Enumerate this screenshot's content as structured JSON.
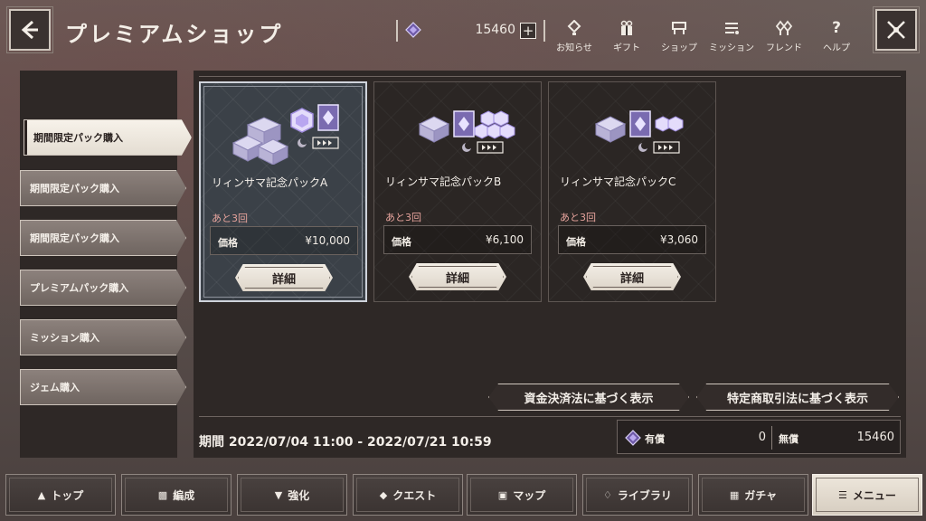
{
  "header": {
    "title": "プレミアムショップ",
    "gem_count": "15460",
    "plus_label": "+",
    "nav": [
      {
        "label": "お知らせ",
        "icon": "notice-icon"
      },
      {
        "label": "ギフト",
        "icon": "gift-icon"
      },
      {
        "label": "ショップ",
        "icon": "shop-icon"
      },
      {
        "label": "ミッション",
        "icon": "mission-icon"
      },
      {
        "label": "フレンド",
        "icon": "friend-icon"
      },
      {
        "label": "ヘルプ",
        "icon": "help-icon"
      }
    ]
  },
  "sidebar": {
    "items": [
      {
        "label": "期間限定パック購入",
        "active": true
      },
      {
        "label": "期間限定パック購入",
        "active": false
      },
      {
        "label": "期間限定パック購入",
        "active": false
      },
      {
        "label": "プレミアムパック購入",
        "active": false
      },
      {
        "label": "ミッション購入",
        "active": false
      },
      {
        "label": "ジェム購入",
        "active": false
      }
    ]
  },
  "cards": [
    {
      "title": "リィンサマ記念パックA",
      "remaining": "あと3回",
      "price_label": "価格",
      "price": "¥10,000",
      "detail_label": "詳細",
      "selected": true
    },
    {
      "title": "リィンサマ記念パックB",
      "remaining": "あと3回",
      "price_label": "価格",
      "price": "¥6,100",
      "detail_label": "詳細",
      "selected": false
    },
    {
      "title": "リィンサマ記念パックC",
      "remaining": "あと3回",
      "price_label": "価格",
      "price": "¥3,060",
      "detail_label": "詳細",
      "selected": false
    }
  ],
  "legal": {
    "payment_act": "資金決済法に基づく表示",
    "commercial_act": "特定商取引法に基づく表示"
  },
  "period": "期間 2022/07/04 11:00 - 2022/07/21 10:59",
  "wallet": {
    "paid_label": "有償",
    "paid_value": "0",
    "free_label": "無償",
    "free_value": "15460"
  },
  "bottom_nav": [
    {
      "label": "トップ"
    },
    {
      "label": "編成"
    },
    {
      "label": "強化"
    },
    {
      "label": "クエスト"
    },
    {
      "label": "マップ"
    },
    {
      "label": "ライブラリ"
    },
    {
      "label": "ガチャ"
    },
    {
      "label": "メニュー",
      "active": true
    }
  ],
  "colors": {
    "accent_remaining": "#e6a39c",
    "panel_bg": "#2e2826",
    "active_tab_bg": "#f7f2ea"
  }
}
